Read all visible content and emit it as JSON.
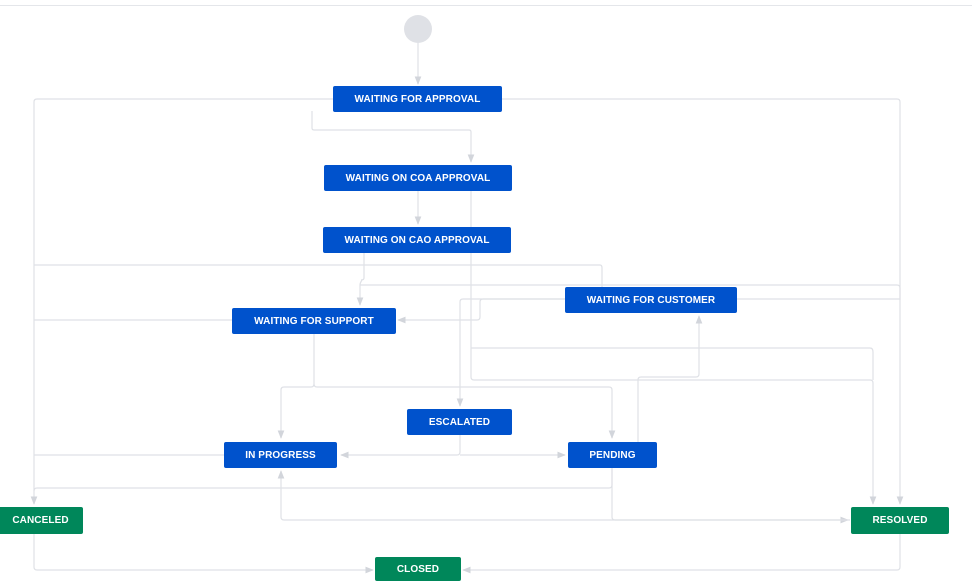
{
  "workflow": {
    "states": {
      "waiting_for_approval": "WAITING FOR APPROVAL",
      "waiting_on_coa_approval": "WAITING ON COA APPROVAL",
      "waiting_on_cao_approval": "WAITING ON CAO APPROVAL",
      "waiting_for_support": "WAITING FOR SUPPORT",
      "waiting_for_customer": "WAITING FOR CUSTOMER",
      "escalated": "ESCALATED",
      "in_progress": "IN PROGRESS",
      "pending": "PENDING",
      "canceled": "CANCELED",
      "resolved": "RESOLVED",
      "closed": "CLOSED"
    },
    "colors": {
      "status_in_progress": "#0052cc",
      "status_done": "#00875a",
      "start_node": "#dfe1e6",
      "transition_line": "#dfe1e6"
    }
  }
}
